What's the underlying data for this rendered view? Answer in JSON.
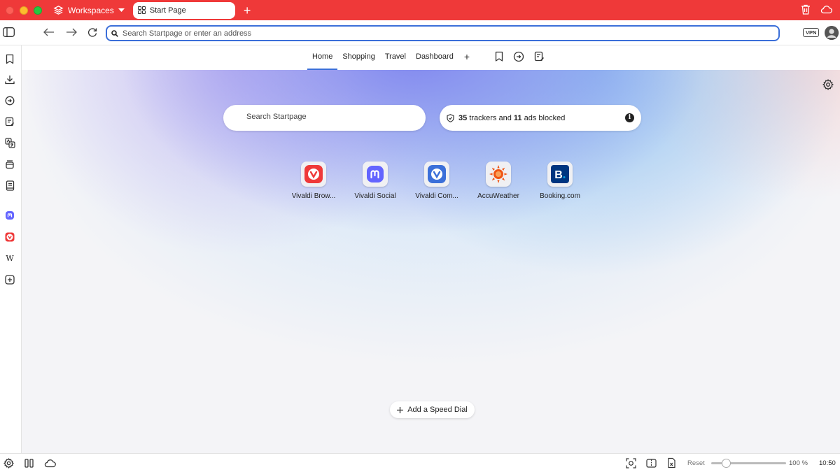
{
  "window": {
    "workspaces_label": "Workspaces",
    "tab_title": "Start Page",
    "new_tab_symbol": "+"
  },
  "address_bar": {
    "placeholder": "Search Startpage or enter an address",
    "vpn_label": "VPN"
  },
  "start_page": {
    "nav_tabs": [
      {
        "label": "Home",
        "active": true
      },
      {
        "label": "Shopping",
        "active": false
      },
      {
        "label": "Travel",
        "active": false
      },
      {
        "label": "Dashboard",
        "active": false
      }
    ],
    "nav_add": "+",
    "search_placeholder": "Search Startpage",
    "trackers": {
      "trackers_count": "35",
      "trackers_text": "trackers and",
      "ads_count": "11",
      "ads_text": "ads blocked"
    },
    "speed_dials": [
      {
        "label": "Vivaldi Brow...",
        "icon": "vivaldi-icon",
        "color": "#ef3939"
      },
      {
        "label": "Vivaldi Social",
        "icon": "mastodon-icon",
        "color": "#6364ff"
      },
      {
        "label": "Vivaldi Com...",
        "icon": "vivaldi-community-icon",
        "color": "#3b6fd9"
      },
      {
        "label": "AccuWeather",
        "icon": "sun-icon",
        "color": "#f05514"
      },
      {
        "label": "Booking.com",
        "icon": "booking-icon",
        "color": "#003580"
      }
    ],
    "add_speed_dial": "Add a Speed Dial"
  },
  "status_bar": {
    "reset_label": "Reset",
    "zoom_level": "100 %",
    "zoom_fraction": 0.2,
    "clock": "10:50"
  },
  "colors": {
    "titlebar": "#ef3939",
    "accent": "#3b6fd9"
  }
}
